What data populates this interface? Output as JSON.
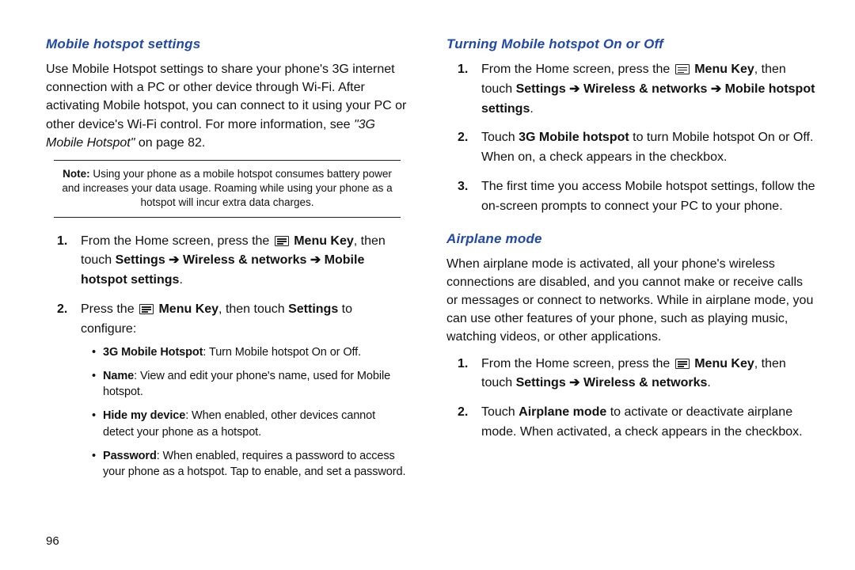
{
  "page_number": "96",
  "left": {
    "heading": "Mobile hotspot settings",
    "intro_a": "Use Mobile Hotspot settings to share your phone's 3G internet connection with a PC or other device through Wi-Fi. After activating Mobile hotspot, you can connect to it using your PC or other device's Wi-Fi control. For more information, see ",
    "intro_ref": "\"3G Mobile Hotspot\"",
    "intro_b": " on page 82.",
    "note_label": "Note:",
    "note_text": " Using your phone as a mobile hotspot consumes battery power and increases your data usage. Roaming while using your phone as a hotspot will incur extra data charges.",
    "step1_a": "From the Home screen, press the ",
    "step1_menukey": " Menu Key",
    "step1_b": ", then touch ",
    "step1_path_settings": "Settings",
    "step1_arrow": " ➔ ",
    "step1_path_wireless": "Wireless & networks",
    "step1_path_mhs": "Mobile hotspot settings",
    "step1_c": ".",
    "step2_a": "Press the ",
    "step2_menukey": " Menu Key",
    "step2_b": ", then touch ",
    "step2_settings": "Settings",
    "step2_c": " to configure:",
    "bullets": {
      "b1_label": "3G Mobile Hotspot",
      "b1_text": ": Turn Mobile hotspot On or Off.",
      "b2_label": "Name",
      "b2_text": ": View and edit your phone's name, used for Mobile hotspot.",
      "b3_label": "Hide my device",
      "b3_text": ": When enabled, other devices cannot detect your phone as a hotspot.",
      "b4_label": "Password",
      "b4_text": ": When enabled, requires a password to access your phone as a hotspot. Tap to enable, and set a password."
    }
  },
  "right": {
    "heading1": "Turning Mobile hotspot On or Off",
    "t1_step1_a": "From the Home screen, press the ",
    "t1_step1_menukey": " Menu Key",
    "t1_step1_b": ", then touch ",
    "t1_step1_settings": "Settings",
    "t1_arrow": " ➔ ",
    "t1_step1_wireless": "Wireless & networks",
    "t1_step1_mhs": "Mobile hotspot settings",
    "t1_step1_c": ".",
    "t1_step2_a": "Touch ",
    "t1_step2_label": "3G Mobile hotspot",
    "t1_step2_b": " to turn Mobile hotspot On or Off. When on, a check appears in the checkbox.",
    "t1_step3": "The first time you access Mobile hotspot settings, follow the on-screen prompts to connect your PC to your phone.",
    "heading2": "Airplane mode",
    "air_intro": "When airplane mode is activated, all your phone's wireless connections are disabled, and you cannot make or receive calls or messages or connect to networks. While in airplane mode, you can use other features of your phone, such as playing music, watching videos, or other applications.",
    "air_step1_a": "From the Home screen, press the ",
    "air_step1_menukey": " Menu Key",
    "air_step1_b": ", then touch ",
    "air_step1_settings": "Settings",
    "air_arrow": " ➔ ",
    "air_step1_wireless": "Wireless & networks",
    "air_step1_c": ".",
    "air_step2_a": "Touch ",
    "air_step2_label": "Airplane mode",
    "air_step2_b": " to activate or deactivate airplane mode. When activated, a check appears in the checkbox."
  }
}
